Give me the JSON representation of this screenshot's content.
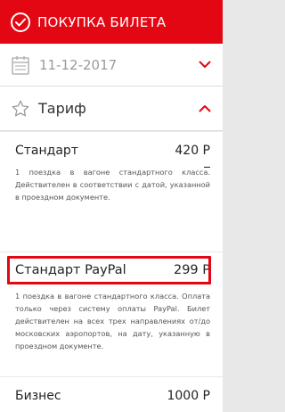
{
  "header": {
    "title": "ПОКУПКА БИЛЕТА",
    "icon": "check-circle-icon",
    "color": "#e30613"
  },
  "date_row": {
    "date": "11-12-2017",
    "icon": "calendar-icon",
    "chevron": "chevron-down-icon"
  },
  "tariff_row": {
    "label": "Тариф",
    "icon": "star-icon",
    "chevron": "chevron-up-icon"
  },
  "options": [
    {
      "name": "Стандарт",
      "price": "420 Р",
      "description": "1 поездка в вагоне стандартного класса. Действителен в соответствии с датой, указанной в проездном документе."
    },
    {
      "name": "Стандарт PayPal",
      "price": "299 Р",
      "selected": true,
      "description": "1 поездка в вагоне стандартного класса. Оплата только через систему оплаты PayPal. Билет действителен на всех трех направлениях от/до московских аэропортов, на дату, указанную в проездном документе."
    },
    {
      "name": "Бизнес",
      "price": "1000 Р"
    }
  ]
}
